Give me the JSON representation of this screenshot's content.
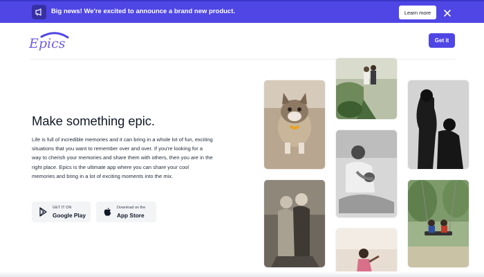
{
  "banner": {
    "message": "Big news! We're excited to announce a brand new product.",
    "cta_label": "Learn more",
    "background": "#4f46e5"
  },
  "header": {
    "logo_text": "Epics",
    "cta_label": "Get it",
    "accent": "#4f46e5"
  },
  "hero": {
    "title": "Make something epic.",
    "body": "Life is full of incredible memories and it can bring in a whole lot of fun, exciting situations that you want to remember over and over. If you're looking for a way to cherish your memories and share them with others, then you are in the right place. Epics is the ultimate app where you can share your cool memories and bring in a lot of exciting moments into the mix."
  },
  "stores": {
    "google": {
      "small": "GET IT ON",
      "big": "Google Play",
      "icon": "google-play-icon"
    },
    "apple": {
      "small": "Download on the",
      "big": "App Store",
      "icon": "apple-icon"
    }
  },
  "gallery": {
    "photos": [
      {
        "name": "cat-photo"
      },
      {
        "name": "wedding-couple-photo"
      },
      {
        "name": "father-baby-photo"
      },
      {
        "name": "pregnant-couple-photo"
      },
      {
        "name": "mother-daughter-photo"
      },
      {
        "name": "kids-on-swing-photo"
      },
      {
        "name": "child-at-beach-photo"
      }
    ]
  }
}
